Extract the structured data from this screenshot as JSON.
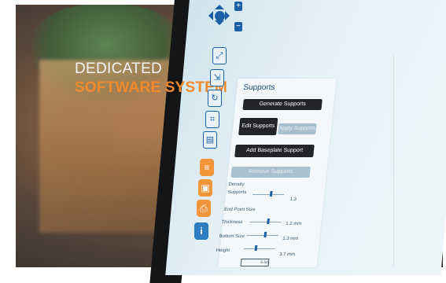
{
  "tagline": {
    "line1": "DEDICATED",
    "line2": "SOFTWARE SYSTEM"
  },
  "toolbar": {
    "zoom_in": "+",
    "zoom_out": "−",
    "tool_icons": [
      "move-tool-icon",
      "scale-tool-icon",
      "rotate-tool-icon",
      "supports-tool-icon",
      "layer-tool-icon"
    ],
    "action_icons": [
      "slice-icon",
      "save-icon",
      "print-icon"
    ],
    "info": "i"
  },
  "supports": {
    "title": "Supports",
    "generate": "Generate Supports",
    "edit": "Edit Supports",
    "apply": "Apply Supports",
    "add_baseplate": "Add Baseplate Support",
    "remove": "Remove Supports",
    "density_label": "Density",
    "supports_label": "Supports",
    "density_value": "1.3",
    "endpoint_label": "End Point Size",
    "thickness_label": "Thickness",
    "thickness_value": "1.2 mm",
    "bottom_label": "Bottom Size",
    "bottom_value": "1.3 mm",
    "height_label": "Height",
    "height_value": "3.7 mm",
    "input_value": "6.50"
  },
  "colors": {
    "accent": "#1c5fa6",
    "orange": "#f28a2c"
  }
}
